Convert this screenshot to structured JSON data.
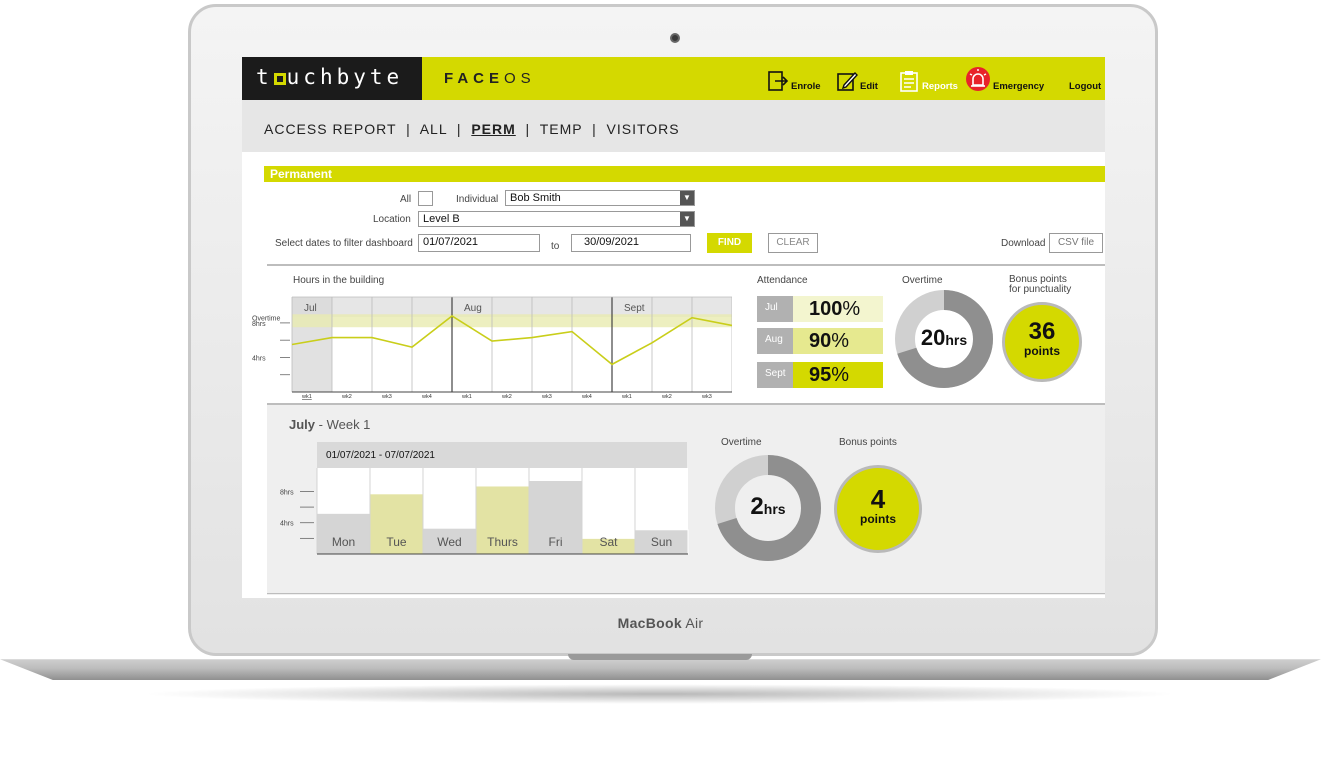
{
  "device": {
    "brand_bold": "MacBook",
    "brand_light": "Air"
  },
  "header": {
    "logo": {
      "part1": "t",
      "part2": "uchbyte"
    },
    "app_name": {
      "bold": "FACE",
      "light": "OS"
    },
    "nav": {
      "enrole": "Enrole",
      "edit": "Edit",
      "reports": "Reports",
      "emergency": "Emergency",
      "logout": "Logout"
    },
    "accent_color": "#d4d900"
  },
  "breadcrumb": {
    "prefix": "ACCESS REPORT  |  ALL  |  ",
    "active": "PERM",
    "suffix": "  |  TEMP  |  VISITORS"
  },
  "section_title": "Permanent",
  "filters": {
    "all_label": "All",
    "individual_label": "Individual",
    "individual_value": "Bob Smith",
    "location_label": "Location",
    "location_value": "Level B",
    "dates_label": "Select dates to filter dashboard",
    "date_from": "01/07/2021",
    "to_label": "to",
    "date_to": "30/09/2021",
    "find": "FIND",
    "clear": "CLEAR",
    "download_label": "Download",
    "csv": "CSV file"
  },
  "hours_chart": {
    "title": "Hours in the building",
    "months": [
      "Jul",
      "Aug",
      "Sept"
    ],
    "y_labels": {
      "overtime": "Overtime",
      "eight": "8hrs",
      "four": "4hrs"
    },
    "week_labels": [
      "wk1",
      "wk2",
      "wk3",
      "wk4",
      "wk1",
      "wk2",
      "wk3",
      "wk4",
      "wk1",
      "wk2",
      "wk3"
    ]
  },
  "chart_data": [
    {
      "type": "line",
      "title": "Hours in the building",
      "categories": [
        "wk1",
        "wk2",
        "wk3",
        "wk4",
        "wk1",
        "wk2",
        "wk3",
        "wk4",
        "wk1",
        "wk2",
        "wk3"
      ],
      "values": [
        5.5,
        6.3,
        6.3,
        5.2,
        8.8,
        5.9,
        6.3,
        7.0,
        3.2,
        5.7,
        8.6,
        7.7
      ],
      "ylim": [
        0,
        11
      ]
    },
    {
      "type": "bar",
      "title": "01/07/2021 - 07/07/2021",
      "categories": [
        "Mon",
        "Tue",
        "Wed",
        "Thurs",
        "Fri",
        "Sat",
        "Sun"
      ],
      "values": [
        5.2,
        7.7,
        3.3,
        8.7,
        9.4,
        2.0,
        3.1
      ],
      "ylim": [
        0,
        11
      ],
      "y_ticks": [
        "8hrs",
        "4hrs"
      ]
    }
  ],
  "attendance": {
    "title": "Attendance",
    "rows": [
      {
        "month": "Jul",
        "value": "100",
        "unit": "%"
      },
      {
        "month": "Aug",
        "value": "90",
        "unit": "%"
      },
      {
        "month": "Sept",
        "value": "95",
        "unit": "%"
      }
    ]
  },
  "overtime_top": {
    "title": "Overtime",
    "value": "20",
    "unit": "hrs",
    "fraction": 0.7
  },
  "bonus_top": {
    "title_line1": "Bonus points",
    "title_line2": "for punctuality",
    "value": "36",
    "unit": "points"
  },
  "week": {
    "month": "July",
    "week_label": " - Week 1"
  },
  "overtime_week": {
    "title": "Overtime",
    "value": "2",
    "unit": "hrs",
    "fraction": 0.7
  },
  "bonus_week": {
    "title": "Bonus points",
    "value": "4",
    "unit": "points"
  }
}
